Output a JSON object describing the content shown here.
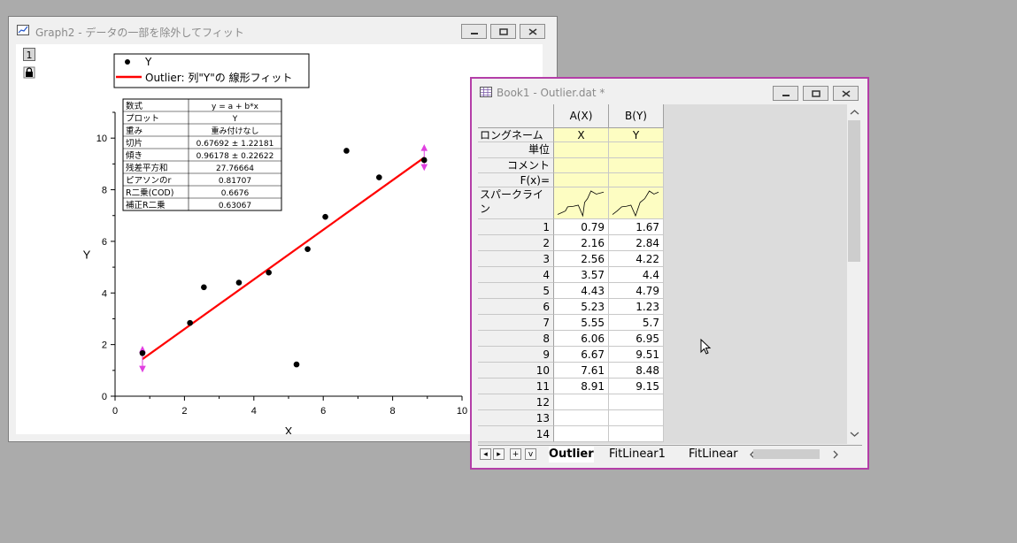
{
  "graph_window": {
    "title": "Graph2 - データの一部を除外してフィット",
    "layer_number": "1"
  },
  "legend": {
    "scatter_label": "Y",
    "line_label": "Outlier: 列\"Y\"の 線形フィット"
  },
  "fit_table": {
    "rows": [
      {
        "label": "数式",
        "value": "y = a + b*x"
      },
      {
        "label": "プロット",
        "value": "Y"
      },
      {
        "label": "重み",
        "value": "重み付けなし"
      },
      {
        "label": "切片",
        "value": "0.67692 ± 1.22181"
      },
      {
        "label": "傾き",
        "value": "0.96178 ± 0.22622"
      },
      {
        "label": "残差平方和",
        "value": "27.76664"
      },
      {
        "label": "ピアソンのr",
        "value": "0.81707"
      },
      {
        "label": "R二乗(COD)",
        "value": "0.6676"
      },
      {
        "label": "補正R二乗",
        "value": "0.63067"
      }
    ]
  },
  "chart_data": {
    "type": "scatter",
    "xlabel": "X",
    "ylabel": "Y",
    "xlim": [
      0,
      10
    ],
    "ylim": [
      0,
      11
    ],
    "x_ticks": [
      "0",
      "2",
      "4",
      "6",
      "8",
      "10"
    ],
    "y_ticks": [
      "0",
      "2",
      "4",
      "6",
      "8",
      "10"
    ],
    "legend_position": "top",
    "grid": false,
    "series": [
      {
        "name": "Y",
        "x": [
          0.79,
          2.16,
          2.56,
          3.57,
          4.43,
          5.23,
          5.55,
          6.06,
          6.67,
          7.61,
          8.91
        ],
        "y": [
          1.67,
          2.84,
          4.22,
          4.4,
          4.79,
          1.23,
          5.7,
          6.95,
          9.51,
          8.48,
          9.15
        ],
        "color": "#000000"
      }
    ],
    "fit_line": {
      "intercept": 0.67692,
      "slope": 0.96178,
      "x_range": [
        0.79,
        8.91
      ],
      "color": "#ff0000"
    },
    "range_marker_color": "#e040e0"
  },
  "book_window": {
    "title": "Book1 - Outlier.dat *",
    "columns": [
      "A(X)",
      "B(Y)"
    ],
    "meta_rows": [
      {
        "label": "ロングネーム",
        "values": [
          "X",
          "Y"
        ]
      },
      {
        "label": "単位",
        "values": [
          "",
          ""
        ]
      },
      {
        "label": "コメント",
        "values": [
          "",
          ""
        ]
      },
      {
        "label": "F(x)=",
        "values": [
          "",
          ""
        ]
      },
      {
        "label": "スパークライン",
        "values": [
          "",
          ""
        ]
      }
    ],
    "rows": [
      {
        "n": "1",
        "a": "0.79",
        "b": "1.67"
      },
      {
        "n": "2",
        "a": "2.16",
        "b": "2.84"
      },
      {
        "n": "3",
        "a": "2.56",
        "b": "4.22"
      },
      {
        "n": "4",
        "a": "3.57",
        "b": "4.4"
      },
      {
        "n": "5",
        "a": "4.43",
        "b": "4.79"
      },
      {
        "n": "6",
        "a": "5.23",
        "b": "1.23"
      },
      {
        "n": "7",
        "a": "5.55",
        "b": "5.7"
      },
      {
        "n": "8",
        "a": "6.06",
        "b": "6.95"
      },
      {
        "n": "9",
        "a": "6.67",
        "b": "9.51"
      },
      {
        "n": "10",
        "a": "7.61",
        "b": "8.48"
      },
      {
        "n": "11",
        "a": "8.91",
        "b": "9.15"
      },
      {
        "n": "12",
        "a": "",
        "b": ""
      },
      {
        "n": "13",
        "a": "",
        "b": ""
      },
      {
        "n": "14",
        "a": "",
        "b": ""
      }
    ],
    "tabs": [
      "Outlier",
      "FitLinear1",
      "FitLinear"
    ],
    "nav_buttons": [
      "◂",
      "▸",
      "+",
      "v"
    ]
  },
  "colors": {
    "book_border": "#b43ea8",
    "meta_bg": "#fdfdc2",
    "desktop": "#ababab"
  }
}
